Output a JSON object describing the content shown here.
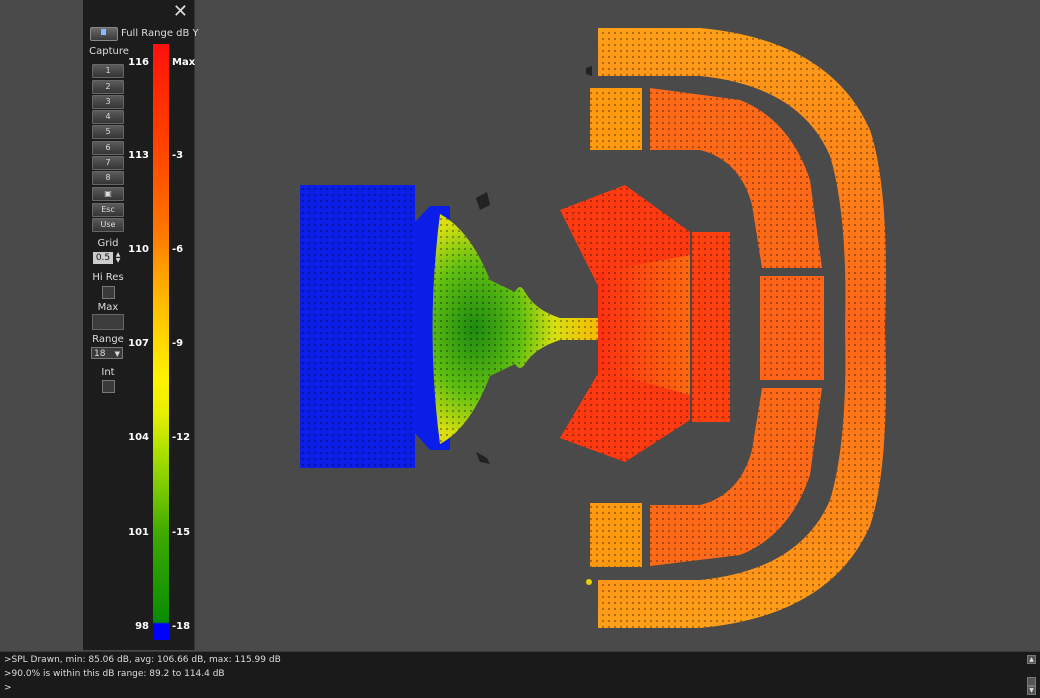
{
  "legend": {
    "title": "Full Range dB Y",
    "capture_label": "Capture",
    "capture_buttons": [
      "1",
      "2",
      "3",
      "4",
      "5",
      "6",
      "7",
      "8"
    ],
    "save_icon": "floppy-disk-icon",
    "esc_label": "Esc",
    "use_label": "Use",
    "grid_label": "Grid",
    "grid_value": "0.5",
    "hires_label": "Hi Res",
    "max_label": "Max",
    "range_label": "Range",
    "range_value": "18",
    "int_label": "Int",
    "ticks_db": [
      "116",
      "113",
      "110",
      "107",
      "104",
      "101",
      "98"
    ],
    "ticks_rel": [
      "Max",
      "-3",
      "-6",
      "-9",
      "-12",
      "-15",
      "-18"
    ]
  },
  "console": {
    "line1": ">SPL Drawn, min: 85.06 dB, avg: 106.66 dB, max: 115.99 dB",
    "line2": ">90.0% is within this dB range: 89.2 to 114.4 dB",
    "line3": ">"
  },
  "colors": {
    "stage": "#0a1ee8",
    "background": "#4a4a4a",
    "panel": "#1c1c1c"
  }
}
